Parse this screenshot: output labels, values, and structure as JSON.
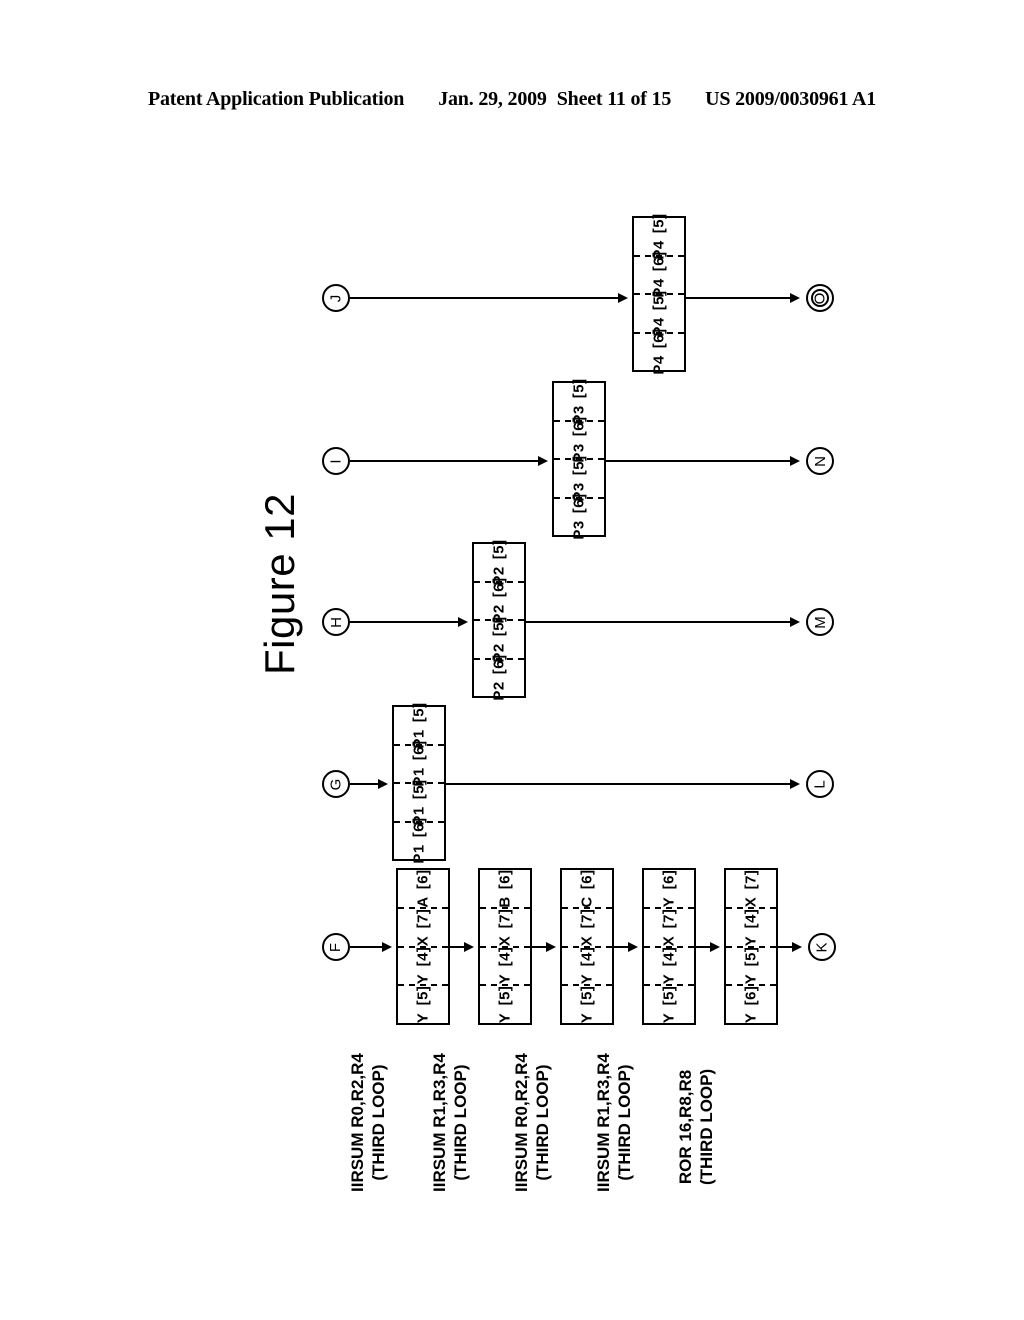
{
  "header": {
    "publication": "Patent Application Publication",
    "date": "Jan. 29, 2009",
    "sheet": "Sheet 11 of 15",
    "number": "US 2009/0030961 A1"
  },
  "figure": {
    "title": "Figure 12"
  },
  "nodes": {
    "left": [
      "J",
      "I",
      "H",
      "G",
      "F"
    ],
    "right": [
      "O",
      "N",
      "M",
      "L",
      "K"
    ]
  },
  "lanes": [
    {
      "id": "lane-j-o",
      "source_node": "J",
      "target_node": "O",
      "stacks": [
        {
          "id": "stack-p4",
          "cells": [
            {
              "sym": "P4",
              "idx": "[5]"
            },
            {
              "sym": "P4",
              "idx": "[6]"
            },
            {
              "sym": "P4",
              "idx": "[5]"
            },
            {
              "sym": "P4",
              "idx": "[6]"
            }
          ]
        }
      ]
    },
    {
      "id": "lane-i-n",
      "source_node": "I",
      "target_node": "N",
      "stacks": [
        {
          "id": "stack-p3",
          "cells": [
            {
              "sym": "P3",
              "idx": "[5]"
            },
            {
              "sym": "P3",
              "idx": "[6]"
            },
            {
              "sym": "P3",
              "idx": "[5]"
            },
            {
              "sym": "P3",
              "idx": "[6]"
            }
          ]
        }
      ]
    },
    {
      "id": "lane-h-m",
      "source_node": "H",
      "target_node": "M",
      "stacks": [
        {
          "id": "stack-p2",
          "cells": [
            {
              "sym": "P2",
              "idx": "[5]"
            },
            {
              "sym": "P2",
              "idx": "[6]"
            },
            {
              "sym": "P2",
              "idx": "[5]"
            },
            {
              "sym": "P2",
              "idx": "[6]"
            }
          ]
        }
      ]
    },
    {
      "id": "lane-g-l",
      "source_node": "G",
      "target_node": "L",
      "stacks": [
        {
          "id": "stack-p1",
          "cells": [
            {
              "sym": "P1",
              "idx": "[5]"
            },
            {
              "sym": "P1",
              "idx": "[6]"
            },
            {
              "sym": "P1",
              "idx": "[5]"
            },
            {
              "sym": "P1",
              "idx": "[6]"
            }
          ]
        }
      ]
    },
    {
      "id": "lane-f-k",
      "source_node": "F",
      "target_node": "K",
      "stacks": [
        {
          "id": "stack-a",
          "cells": [
            {
              "sym": "A",
              "idx": "[6]"
            },
            {
              "sym": "X",
              "idx": "[7]"
            },
            {
              "sym": "Y",
              "idx": "[4]"
            },
            {
              "sym": "Y",
              "idx": "[5]"
            }
          ]
        },
        {
          "id": "stack-b",
          "cells": [
            {
              "sym": "B",
              "idx": "[6]"
            },
            {
              "sym": "X",
              "idx": "[7]"
            },
            {
              "sym": "Y",
              "idx": "[4]"
            },
            {
              "sym": "Y",
              "idx": "[5]"
            }
          ]
        },
        {
          "id": "stack-c",
          "cells": [
            {
              "sym": "C",
              "idx": "[6]"
            },
            {
              "sym": "X",
              "idx": "[7]"
            },
            {
              "sym": "Y",
              "idx": "[4]"
            },
            {
              "sym": "Y",
              "idx": "[5]"
            }
          ]
        },
        {
          "id": "stack-y",
          "cells": [
            {
              "sym": "Y",
              "idx": "[6]"
            },
            {
              "sym": "X",
              "idx": "[7]"
            },
            {
              "sym": "Y",
              "idx": "[4]"
            },
            {
              "sym": "Y",
              "idx": "[5]"
            }
          ]
        },
        {
          "id": "stack-x",
          "cells": [
            {
              "sym": "X",
              "idx": "[7]"
            },
            {
              "sym": "Y",
              "idx": "[4]"
            },
            {
              "sym": "Y",
              "idx": "[5]"
            },
            {
              "sym": "Y",
              "idx": "[6]"
            }
          ]
        }
      ]
    }
  ],
  "instructions": [
    {
      "line1": "IIRSUM R0,R2,R4",
      "line2": "(THIRD LOOP)"
    },
    {
      "line1": "IIRSUM R1,R3,R4",
      "line2": "(THIRD LOOP)"
    },
    {
      "line1": "IIRSUM R0,R2,R4",
      "line2": "(THIRD LOOP)"
    },
    {
      "line1": "IIRSUM R1,R3,R4",
      "line2": "(THIRD LOOP)"
    },
    {
      "line1": "ROR 16,R8,R8",
      "line2": "(THIRD LOOP)"
    }
  ],
  "colors": {
    "ink": "#000000",
    "paper": "#ffffff"
  }
}
